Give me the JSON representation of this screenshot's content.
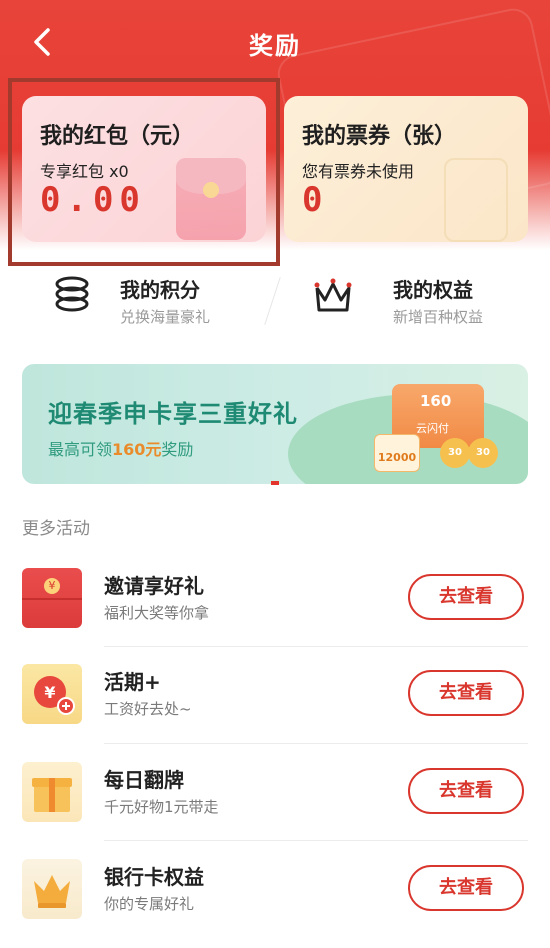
{
  "header": {
    "title": "奖励"
  },
  "cards": {
    "redpacket": {
      "title": "我的红包（元）",
      "sub_label": "专享红包 x0",
      "value": "0.00"
    },
    "ticket": {
      "title": "我的票券（张）",
      "sub_label": "您有票券未使用",
      "value": "0"
    }
  },
  "quick_links": [
    {
      "label": "我的积分",
      "desc": "兑换海量豪礼",
      "icon": "coin-stack-icon"
    },
    {
      "label": "我的权益",
      "desc": "新增百种权益",
      "icon": "crown-icon"
    }
  ],
  "banner": {
    "title": "迎春季申卡享三重好礼",
    "sub_prefix": "最高可领",
    "sub_amount": "160元",
    "sub_suffix": "奖励",
    "box_label": "160",
    "brand": "云闪付",
    "coupon_label": "12000",
    "coins": [
      "30",
      "30"
    ]
  },
  "section": {
    "title": "更多活动"
  },
  "activities": [
    {
      "title": "邀请享好礼",
      "desc": "福利大奖等你拿",
      "button": "去查看",
      "icon": "red-envelope-icon"
    },
    {
      "title": "活期+",
      "desc": "工资好去处~",
      "button": "去查看",
      "icon": "yuan-coin-plus-icon"
    },
    {
      "title": "每日翻牌",
      "desc": "千元好物1元带走",
      "button": "去查看",
      "icon": "gift-box-icon"
    },
    {
      "title": "银行卡权益",
      "desc": "你的专属好礼",
      "button": "去查看",
      "icon": "crown-icon"
    }
  ],
  "colors": {
    "accent": "#d9362d",
    "header_red": "#e63b33",
    "banner_green": "#1f8a73",
    "highlight_border": "#a33a2e"
  }
}
